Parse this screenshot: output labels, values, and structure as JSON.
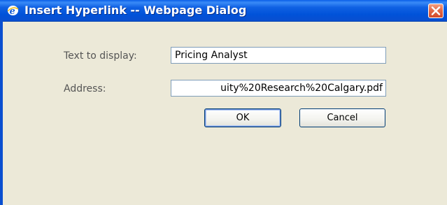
{
  "window": {
    "title": "Insert Hyperlink -- Webpage Dialog"
  },
  "form": {
    "text_to_display_label": "Text to display:",
    "text_to_display_value": "Pricing Analyst",
    "address_label": "Address:",
    "address_value": "uity%20Research%20Calgary.pdf"
  },
  "buttons": {
    "ok_label": "OK",
    "cancel_label": "Cancel"
  },
  "icons": {
    "app": "ie-icon",
    "close": "close-icon"
  },
  "colors": {
    "title_bar": "#0a4fd0",
    "dialog_background": "#ece9d8",
    "close_button": "#e36b4a",
    "field_border": "#7f9db9",
    "button_border": "#003c74"
  }
}
